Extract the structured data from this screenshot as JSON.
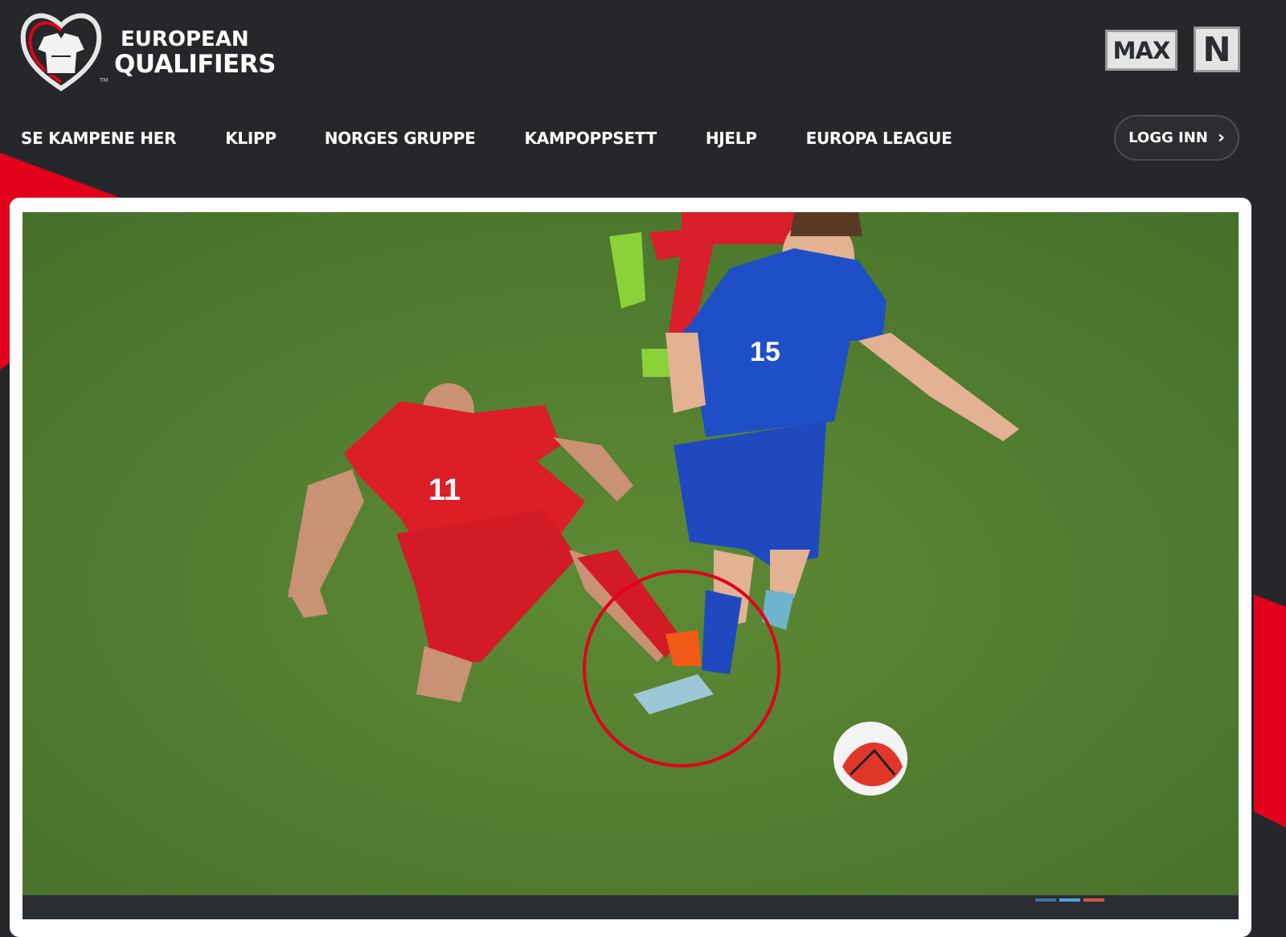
{
  "header": {
    "logo": {
      "line1": "EUROPEAN",
      "line2": "QUALIFIERS",
      "trademark": "TM",
      "icon": "qualifiers-logo-icon"
    },
    "partner_max": "MAX",
    "partner_n": "N"
  },
  "nav": {
    "items": [
      {
        "label": "SE KAMPENE HER"
      },
      {
        "label": "KLIPP"
      },
      {
        "label": "NORGES GRUPPE"
      },
      {
        "label": "KAMPOPPSETT"
      },
      {
        "label": "HJELP"
      },
      {
        "label": "EUROPA LEAGUE"
      }
    ],
    "login_label": "LOGG INN",
    "login_icon": "chevron-right-icon"
  },
  "video": {
    "red_player_number": "11",
    "blue_player_number": "15",
    "highlight": "red-circle-annotation"
  },
  "colors": {
    "background": "#25272b",
    "accent_red": "#e3001b",
    "pitch": "#4f7a2c"
  }
}
